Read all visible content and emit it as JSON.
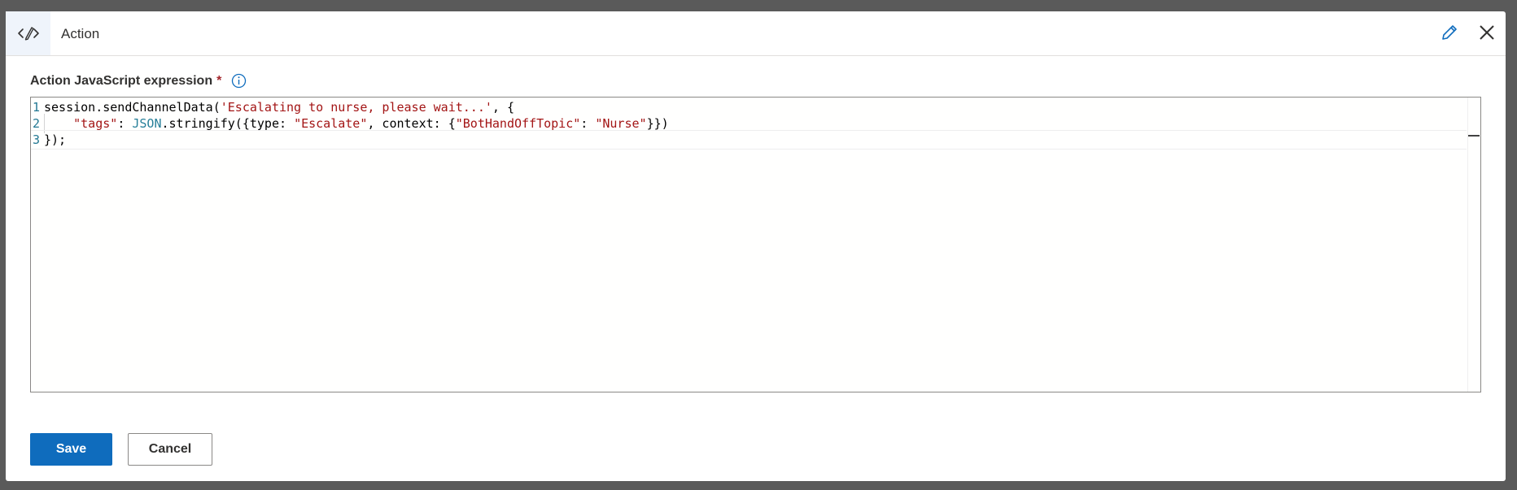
{
  "header": {
    "title": "Action",
    "icon": "code-edit-icon",
    "edit_icon": "pencil-icon",
    "close_icon": "close-icon"
  },
  "field": {
    "label": "Action JavaScript expression",
    "required_marker": "*",
    "info_icon": "info-icon"
  },
  "editor": {
    "lines": [
      {
        "number": "1",
        "tokens": [
          {
            "text": "session.sendChannelData(",
            "kind": "plain"
          },
          {
            "text": "'Escalating to nurse, please wait...'",
            "kind": "str"
          },
          {
            "text": ", {",
            "kind": "plain"
          }
        ]
      },
      {
        "number": "2",
        "tokens": [
          {
            "text": "    ",
            "kind": "plain"
          },
          {
            "text": "\"tags\"",
            "kind": "str"
          },
          {
            "text": ": ",
            "kind": "plain"
          },
          {
            "text": "JSON",
            "kind": "type"
          },
          {
            "text": ".stringify({type: ",
            "kind": "plain"
          },
          {
            "text": "\"Escalate\"",
            "kind": "str"
          },
          {
            "text": ", context: {",
            "kind": "plain"
          },
          {
            "text": "\"BotHandOffTopic\"",
            "kind": "str"
          },
          {
            "text": ": ",
            "kind": "plain"
          },
          {
            "text": "\"Nurse\"",
            "kind": "str"
          },
          {
            "text": "}})",
            "kind": "plain"
          }
        ]
      },
      {
        "number": "3",
        "tokens": [
          {
            "text": "});",
            "kind": "plain"
          }
        ]
      }
    ]
  },
  "footer": {
    "save_label": "Save",
    "cancel_label": "Cancel"
  },
  "colors": {
    "primary": "#0f6cbd",
    "string": "#a31515",
    "type": "#267f99",
    "line_number": "#237893",
    "required": "#a4262c"
  }
}
